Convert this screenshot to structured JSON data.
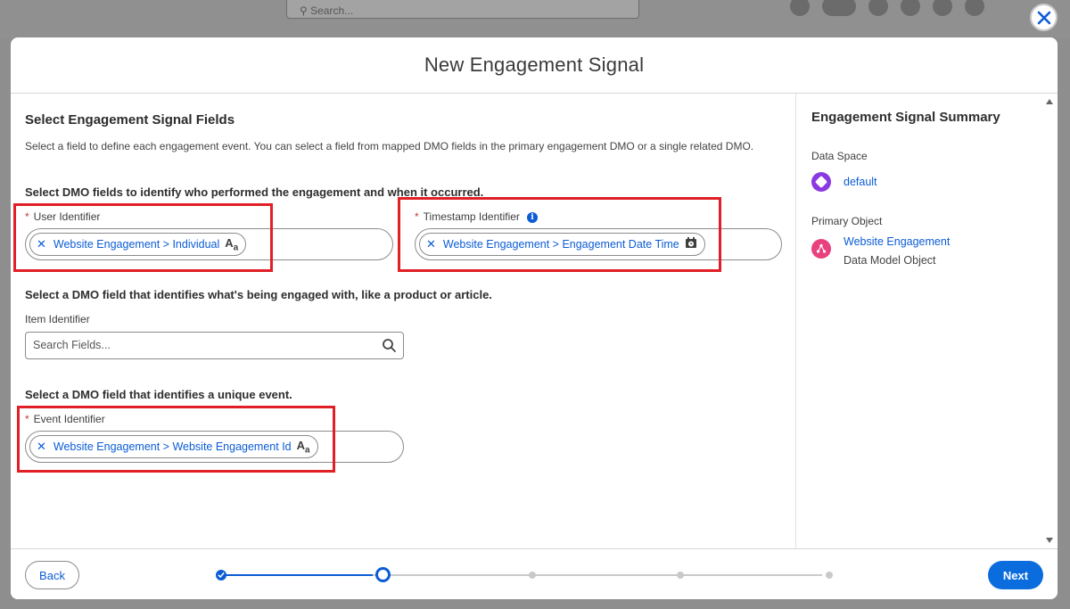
{
  "background": {
    "search_placeholder": "Search..."
  },
  "modal": {
    "title": "New Engagement Signal"
  },
  "form": {
    "section_title": "Select Engagement Signal Fields",
    "description": "Select a field to define each engagement event. You can select a field from mapped DMO fields in the primary engagement DMO or a single related DMO.",
    "who_heading": "Select DMO fields to identify who performed the engagement and when it occurred.",
    "user_identifier": {
      "required_mark": "*",
      "label": "User Identifier",
      "value": "Website Engagement > Individual",
      "type_icon": "text-type-icon"
    },
    "timestamp_identifier": {
      "required_mark": "*",
      "label": "Timestamp Identifier",
      "value": "Website Engagement > Engagement Date Time",
      "type_icon": "datetime-type-icon"
    },
    "item_heading": "Select a DMO field that identifies what's being engaged with, like a product or article.",
    "item_identifier": {
      "label": "Item Identifier",
      "placeholder": "Search Fields..."
    },
    "event_heading": "Select a DMO field that identifies a unique event.",
    "event_identifier": {
      "required_mark": "*",
      "label": "Event Identifier",
      "value": "Website Engagement > Website Engagement Id",
      "type_icon": "text-type-icon"
    }
  },
  "summary": {
    "title": "Engagement Signal Summary",
    "data_space_label": "Data Space",
    "data_space_value": "default",
    "primary_object_label": "Primary Object",
    "primary_object_name": "Website Engagement",
    "primary_object_type": "Data Model Object"
  },
  "footer": {
    "back_label": "Back",
    "next_label": "Next",
    "progress": {
      "total_steps": 5,
      "current_step": 2
    }
  },
  "colors": {
    "brand_blue": "#0b5cd5",
    "highlight_red": "#e01f26",
    "data_space_icon": "#8a39e0",
    "primary_object_icon": "#e8417e"
  }
}
